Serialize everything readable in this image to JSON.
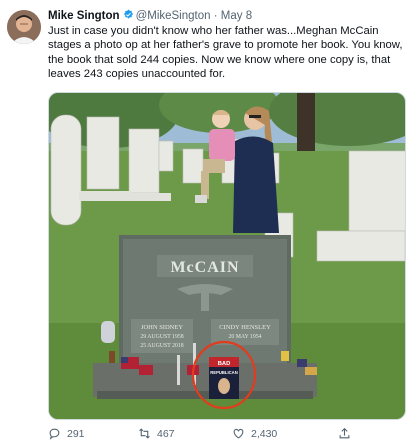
{
  "author": {
    "name": "Mike Sington",
    "handle": "@MikeSington",
    "separator": "·",
    "date": "May 8"
  },
  "tweet": {
    "text": "Just in case you didn't know who her father was...Meghan McCain stages a photo op at her father's grave to promote her book. You know, the book that sold 244 copies. Now we know where one copy is, that leaves 243 copies unaccounted for."
  },
  "media": {
    "headstone_name": "McCAIN",
    "left_plaque": [
      "JOHN SIDNEY",
      "29 AUGUST 1958",
      "25 AUGUST 2018"
    ],
    "right_plaque": [
      "CINDY HENSLEY",
      "20 MAY 1954"
    ],
    "book_cover": [
      "BAD",
      "REPUBLICAN"
    ],
    "highlight_color": "#e23b1e"
  },
  "actions": {
    "reply_count": "291",
    "retweet_count": "467",
    "like_count": "2,430",
    "icons": [
      "reply-icon",
      "retweet-icon",
      "like-icon",
      "share-icon"
    ]
  }
}
